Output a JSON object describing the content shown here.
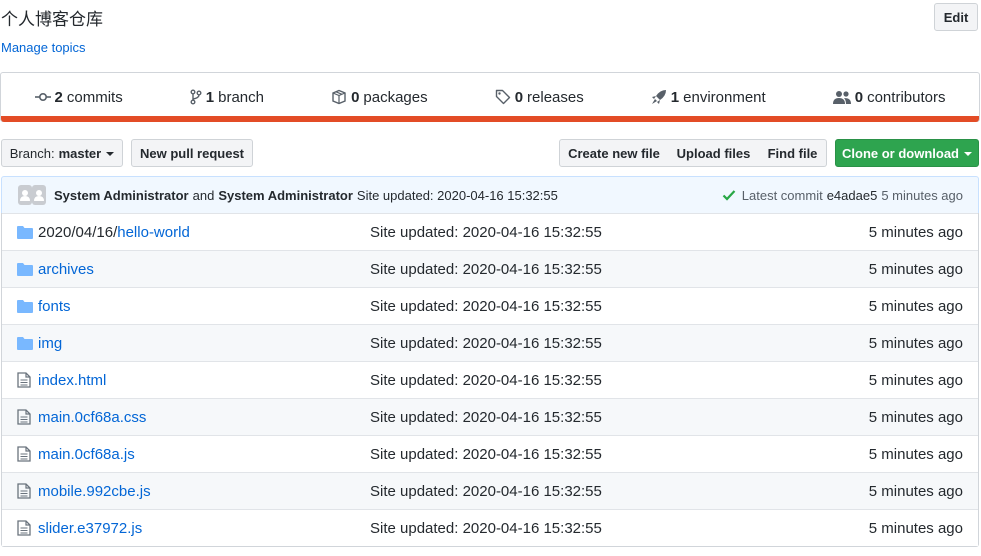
{
  "header": {
    "title": "个人博客仓库",
    "manage_topics": "Manage topics",
    "edit_label": "Edit"
  },
  "summary": {
    "commits": {
      "count": "2",
      "label": "commits"
    },
    "branch": {
      "count": "1",
      "label": "branch"
    },
    "packages": {
      "count": "0",
      "label": "packages"
    },
    "releases": {
      "count": "0",
      "label": "releases"
    },
    "environment": {
      "count": "1",
      "label": "environment"
    },
    "contributors": {
      "count": "0",
      "label": "contributors"
    },
    "language_bar_color": "#e34c26"
  },
  "toolbar": {
    "branch_prefix": "Branch:",
    "branch_name": "master",
    "new_pull_request": "New pull request",
    "create_new_file": "Create new file",
    "upload_files": "Upload files",
    "find_file": "Find file",
    "clone_or_download": "Clone or download"
  },
  "commit": {
    "author1": "System Administrator",
    "and": "and",
    "author2": "System Administrator",
    "message": "Site updated: 2020-04-16 15:32:55",
    "latest_label": "Latest commit",
    "sha": "e4adae5",
    "age": "5 minutes ago"
  },
  "files": [
    {
      "type": "folder",
      "prefix": "2020/04/16/",
      "name": "hello-world",
      "message": "Site updated: 2020-04-16 15:32:55",
      "age": "5 minutes ago"
    },
    {
      "type": "folder",
      "prefix": "",
      "name": "archives",
      "message": "Site updated: 2020-04-16 15:32:55",
      "age": "5 minutes ago"
    },
    {
      "type": "folder",
      "prefix": "",
      "name": "fonts",
      "message": "Site updated: 2020-04-16 15:32:55",
      "age": "5 minutes ago"
    },
    {
      "type": "folder",
      "prefix": "",
      "name": "img",
      "message": "Site updated: 2020-04-16 15:32:55",
      "age": "5 minutes ago"
    },
    {
      "type": "file",
      "prefix": "",
      "name": "index.html",
      "message": "Site updated: 2020-04-16 15:32:55",
      "age": "5 minutes ago"
    },
    {
      "type": "file",
      "prefix": "",
      "name": "main.0cf68a.css",
      "message": "Site updated: 2020-04-16 15:32:55",
      "age": "5 minutes ago"
    },
    {
      "type": "file",
      "prefix": "",
      "name": "main.0cf68a.js",
      "message": "Site updated: 2020-04-16 15:32:55",
      "age": "5 minutes ago"
    },
    {
      "type": "file",
      "prefix": "",
      "name": "mobile.992cbe.js",
      "message": "Site updated: 2020-04-16 15:32:55",
      "age": "5 minutes ago"
    },
    {
      "type": "file",
      "prefix": "",
      "name": "slider.e37972.js",
      "message": "Site updated: 2020-04-16 15:32:55",
      "age": "5 minutes ago"
    }
  ]
}
